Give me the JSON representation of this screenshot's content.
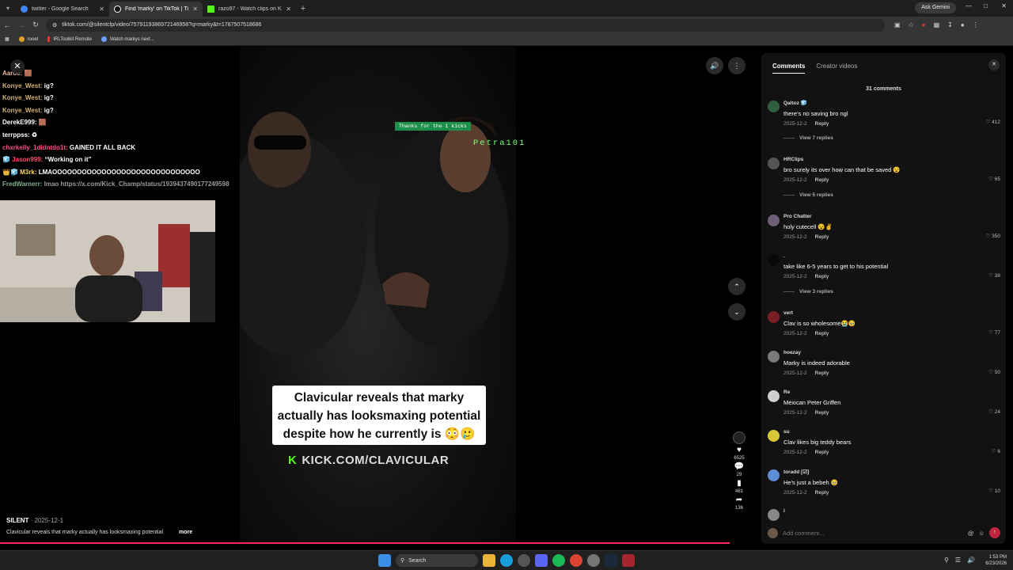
{
  "browser": {
    "tabs": [
      {
        "title": "twitter - Google Search",
        "color": "#4285f4",
        "active": false
      },
      {
        "title": "Find 'marky' on TikTok | Ti...",
        "color": "#111111",
        "active": true
      },
      {
        "title": "razo97 - Watch clips on Kick",
        "color": "#53fc18",
        "active": false
      }
    ],
    "ask_gemini": "Ask Gemini",
    "url": "tiktok.com/@silentclp/video/7579119386972146958?q=marky&t=1787507518686",
    "bookmarks": [
      "rooet",
      "IRLToolkit Remote",
      "Watch markys next..."
    ]
  },
  "stream": {
    "chat": [
      {
        "user": "Aaroe:",
        "msg": "🟫",
        "color": "#e9b7a0"
      },
      {
        "user": "Konye_West:",
        "msg": "ig?",
        "color": "#d4b17a"
      },
      {
        "user": "Konye_West:",
        "msg": "ig?",
        "color": "#d4b17a"
      },
      {
        "user": "Konye_West:",
        "msg": "ig?",
        "color": "#d4b17a"
      },
      {
        "user": "DerekE999:",
        "msg": "🟫",
        "color": "#ffffff"
      },
      {
        "user": "terrppss:",
        "msg": "♻",
        "color": "#ffffff"
      },
      {
        "user": "chxrkelly_1didntdo1t:",
        "msg": "GAINED IT ALL BACK",
        "color": "#ff4f8b"
      },
      {
        "user": "🧊 Jason999:",
        "msg": "“Working on it”",
        "color": "#ff4f6b"
      },
      {
        "user": "👑🧊 M3rk:",
        "msg": "LMAOOOOOOOOOOOOOOOOOOOOOOOOOOOOOO",
        "color": "#ffd866"
      },
      {
        "user": "FredWarnerr:",
        "msg": "lmao https://x.com/Kick_Champ/status/1939437490177249598",
        "color": "#7fb08f"
      }
    ],
    "thanks_banner": "Thanks for the 1 kicks",
    "petra": "Petra101",
    "caption": "Clavicular reveals that marky actually has looksmaxing potential despite how he currently is 😳🥲",
    "kick_url": "KICK.COM/CLAVICULAR"
  },
  "video": {
    "creator": "SILENT",
    "date": "2025-12-1",
    "description": "Clavicular reveals that marky actually has looksmaxing potential",
    "more": "more",
    "actions": {
      "likes": "6525",
      "comments": "29",
      "saves": "481",
      "shares": "136"
    }
  },
  "comments_panel": {
    "tab_comments": "Comments",
    "tab_creator": "Creator videos",
    "count": "31 comments",
    "reply_label": "Reply",
    "items": [
      {
        "user": "Qaltoz 🧊",
        "text": "there's no saving bro ngl",
        "date": "2025-12-2",
        "likes": "412",
        "avatar": "#2f5e3c",
        "replies": "View 7 replies"
      },
      {
        "user": "HRClips",
        "text": "bro surely its over how can that be saved 😵",
        "date": "2025-12-2",
        "likes": "65",
        "avatar": "#555555",
        "replies": "View 5 replies"
      },
      {
        "user": "Pro Chatter",
        "text": "holy cutecell 😵✌️",
        "date": "2025-12-2",
        "likes": "350",
        "avatar": "#6f5f78",
        "replies": ""
      },
      {
        "user": ".",
        "text": "take like 6-5 years to get to his potential",
        "date": "2025-12-2",
        "likes": "38",
        "avatar": "#0a0a0a",
        "replies": "View 3 replies"
      },
      {
        "user": "vert",
        "text": "Clav is so wholesome😭🥹",
        "date": "2025-12-2",
        "likes": "77",
        "avatar": "#7a1f23",
        "replies": ""
      },
      {
        "user": "hoezay",
        "text": "Marky is indeed adorable",
        "date": "2025-12-2",
        "likes": "50",
        "avatar": "#7b7b7b",
        "replies": ""
      },
      {
        "user": "Re",
        "text": "Mexican Peter Griffen",
        "date": "2025-12-2",
        "likes": "24",
        "avatar": "#cfcfcf",
        "replies": ""
      },
      {
        "user": "su",
        "text": "Clav likes big teddy bears",
        "date": "2025-12-2",
        "likes": "6",
        "avatar": "#d8c837",
        "replies": ""
      },
      {
        "user": "toradd [☑]",
        "text": "He's just a bebeh 🥹",
        "date": "2025-12-2",
        "likes": "10",
        "avatar": "#5e8fd6",
        "replies": ""
      }
    ],
    "last_user": "i",
    "add_placeholder": "Add comment..."
  },
  "taskbar": {
    "search": "Search",
    "time": "1:53 PM",
    "date": "6/23/2026"
  }
}
